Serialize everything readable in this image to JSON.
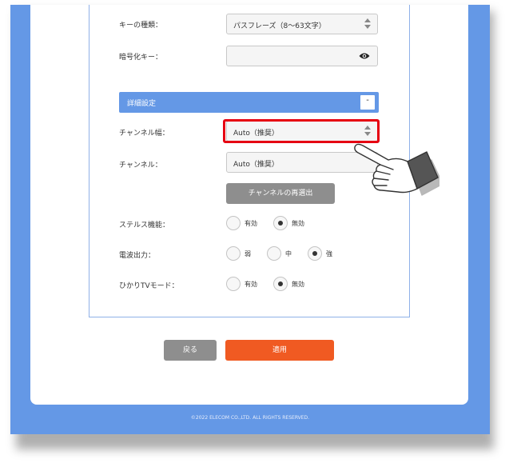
{
  "form": {
    "key_type": {
      "label": "キーの種類：",
      "value": "パスフレーズ（8～63文字）"
    },
    "encryption_key": {
      "label": "暗号化キー：",
      "value": "",
      "icon": "eye-icon"
    }
  },
  "advanced": {
    "title": "詳細設定",
    "toggle": "-",
    "channel_width": {
      "label": "チャンネル幅：",
      "value": "Auto（推奨）"
    },
    "channel": {
      "label": "チャンネル：",
      "value": "Auto（推奨）"
    },
    "reselect_button": "チャンネルの再選出",
    "stealth": {
      "label": "ステルス機能：",
      "options": [
        "有効",
        "無効"
      ],
      "selected": 1
    },
    "radio_power": {
      "label": "電波出力：",
      "options": [
        "弱",
        "中",
        "強"
      ],
      "selected": 2
    },
    "hikari_tv": {
      "label": "ひかりTVモード：",
      "options": [
        "有効",
        "無効"
      ],
      "selected": 1
    }
  },
  "actions": {
    "back": "戻る",
    "apply": "適用"
  },
  "footer": {
    "copyright": "©2022 ELECOM CO.,LTD. ALL RIGHTS RESERVED."
  },
  "colors": {
    "frame": "#6498e6",
    "apply": "#f05a22",
    "highlight": "#e60012",
    "gray_button": "#8e8e8e"
  }
}
